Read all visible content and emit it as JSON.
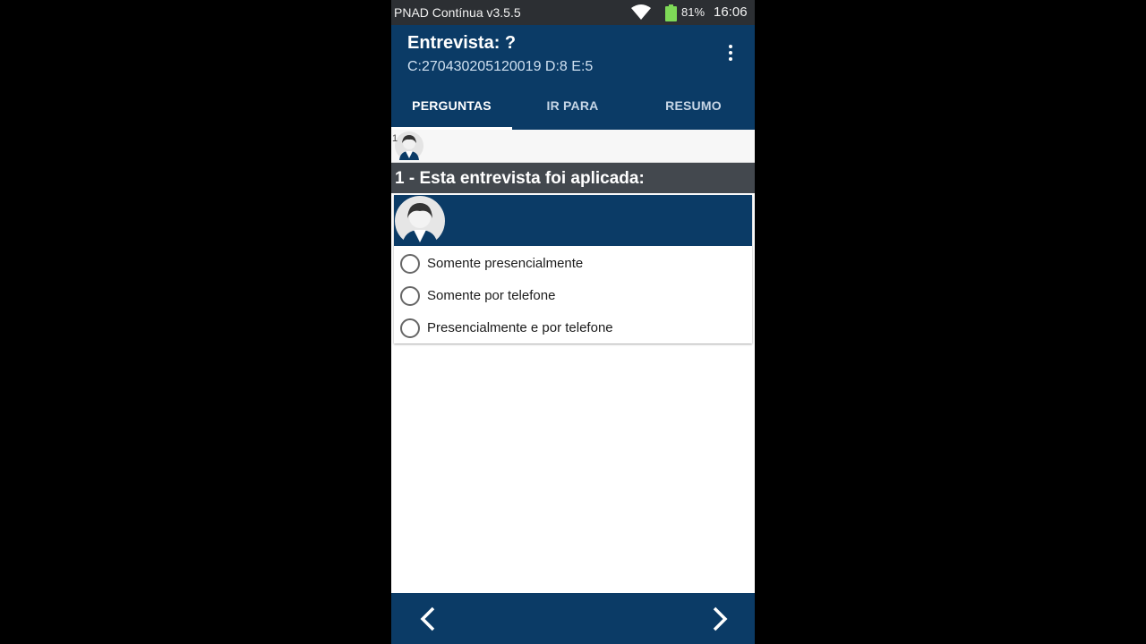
{
  "status_bar": {
    "app_name": "PNAD Contínua v3.5.5",
    "battery_percent": "81%",
    "time": "16:06",
    "icons": [
      "wifi-icon",
      "battery-icon"
    ],
    "battery_color": "#7ed957"
  },
  "app_bar": {
    "title": "Entrevista: ?",
    "subtitle": "C:270430205120019 D:8 E:5",
    "menu_icon": "more-vert-icon",
    "color": "#0b3b66"
  },
  "tabs": [
    {
      "label": "PERGUNTAS",
      "active": true
    },
    {
      "label": "IR PARA",
      "active": false
    },
    {
      "label": "RESUMO",
      "active": false
    }
  ],
  "strip": {
    "number": "1",
    "icon": "interviewer-avatar-icon"
  },
  "question": {
    "title": "1 - Esta entrevista foi aplicada:",
    "icon": "interviewer-avatar-icon",
    "options": [
      {
        "label": "Somente presencialmente",
        "selected": false
      },
      {
        "label": "Somente por telefone",
        "selected": false
      },
      {
        "label": "Presencialmente e por telefone",
        "selected": false
      }
    ]
  },
  "bottom_nav": {
    "prev_icon": "chevron-left-icon",
    "next_icon": "chevron-right-icon"
  }
}
